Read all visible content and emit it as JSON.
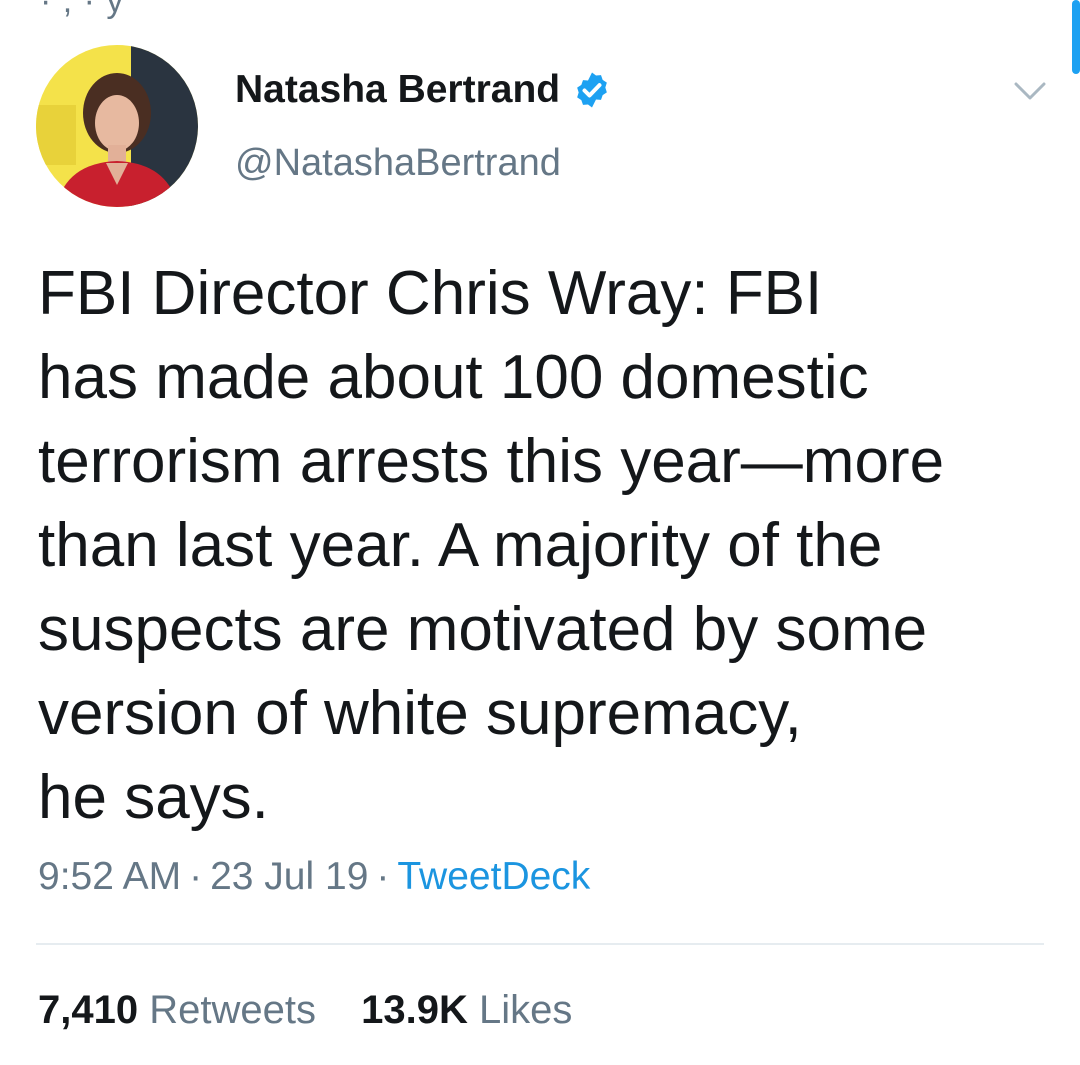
{
  "top_fragment": "·   ,   ·  y",
  "author": {
    "name": "Natasha Bertrand",
    "handle": "@NatashaBertrand",
    "verified": true
  },
  "tweet": {
    "lines": [
      "FBI Director Chris Wray: FBI",
      "has made about 100 domestic",
      "terrorism arrests this year—more",
      "than last year. A majority of the",
      "suspects are motivated by some",
      "version of white supremacy,",
      "he says."
    ]
  },
  "meta": {
    "time": "9:52 AM",
    "separator": "·",
    "date": "23 Jul 19",
    "source": "TweetDeck"
  },
  "stats": {
    "retweets_count": "7,410",
    "retweets_label": "Retweets",
    "likes_count": "13.9K",
    "likes_label": "Likes"
  },
  "icons": {
    "verified": "verified-badge-icon",
    "menu": "chevron-down-icon"
  },
  "colors": {
    "accent": "#1da1f2",
    "link": "#1b95e0",
    "secondary_text": "#657786",
    "primary_text": "#14171a"
  }
}
